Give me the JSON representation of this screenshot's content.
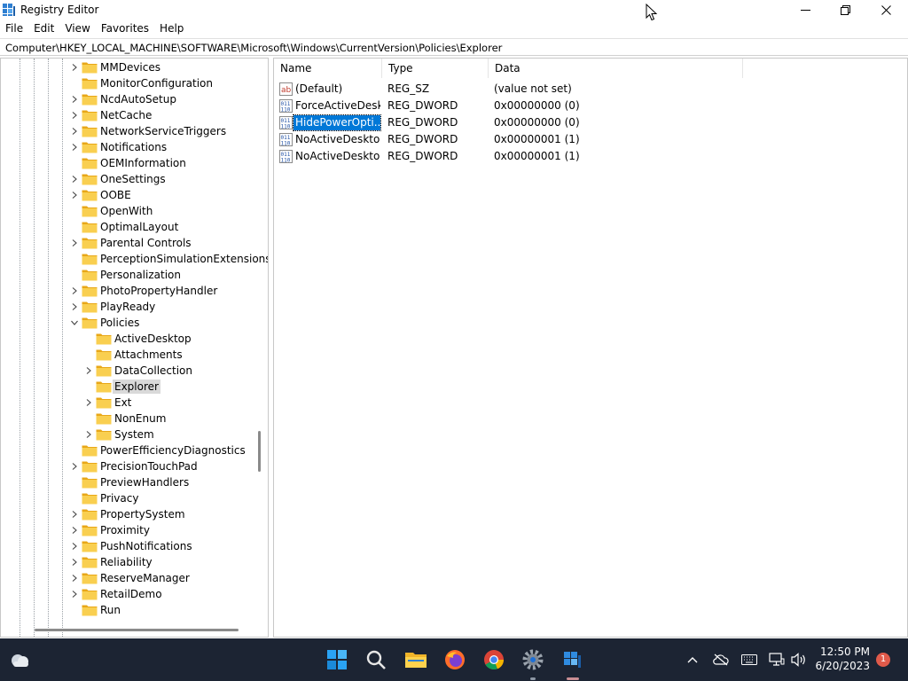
{
  "window": {
    "title": "Registry Editor"
  },
  "menu": [
    "File",
    "Edit",
    "View",
    "Favorites",
    "Help"
  ],
  "address": "Computer\\HKEY_LOCAL_MACHINE\\SOFTWARE\\Microsoft\\Windows\\CurrentVersion\\Policies\\Explorer",
  "tree": [
    {
      "label": "MMDevices",
      "level": 0,
      "chevron": "right"
    },
    {
      "label": "MonitorConfiguration",
      "level": 0,
      "chevron": "none"
    },
    {
      "label": "NcdAutoSetup",
      "level": 0,
      "chevron": "right"
    },
    {
      "label": "NetCache",
      "level": 0,
      "chevron": "right"
    },
    {
      "label": "NetworkServiceTriggers",
      "level": 0,
      "chevron": "right"
    },
    {
      "label": "Notifications",
      "level": 0,
      "chevron": "right"
    },
    {
      "label": "OEMInformation",
      "level": 0,
      "chevron": "none"
    },
    {
      "label": "OneSettings",
      "level": 0,
      "chevron": "right"
    },
    {
      "label": "OOBE",
      "level": 0,
      "chevron": "right"
    },
    {
      "label": "OpenWith",
      "level": 0,
      "chevron": "none"
    },
    {
      "label": "OptimalLayout",
      "level": 0,
      "chevron": "none"
    },
    {
      "label": "Parental Controls",
      "level": 0,
      "chevron": "right"
    },
    {
      "label": "PerceptionSimulationExtensions",
      "level": 0,
      "chevron": "none"
    },
    {
      "label": "Personalization",
      "level": 0,
      "chevron": "none"
    },
    {
      "label": "PhotoPropertyHandler",
      "level": 0,
      "chevron": "right"
    },
    {
      "label": "PlayReady",
      "level": 0,
      "chevron": "right"
    },
    {
      "label": "Policies",
      "level": 0,
      "chevron": "down"
    },
    {
      "label": "ActiveDesktop",
      "level": 1,
      "chevron": "none"
    },
    {
      "label": "Attachments",
      "level": 1,
      "chevron": "none"
    },
    {
      "label": "DataCollection",
      "level": 1,
      "chevron": "right"
    },
    {
      "label": "Explorer",
      "level": 1,
      "chevron": "none",
      "selected": true
    },
    {
      "label": "Ext",
      "level": 1,
      "chevron": "right"
    },
    {
      "label": "NonEnum",
      "level": 1,
      "chevron": "none"
    },
    {
      "label": "System",
      "level": 1,
      "chevron": "right"
    },
    {
      "label": "PowerEfficiencyDiagnostics",
      "level": 0,
      "chevron": "none"
    },
    {
      "label": "PrecisionTouchPad",
      "level": 0,
      "chevron": "right"
    },
    {
      "label": "PreviewHandlers",
      "level": 0,
      "chevron": "none"
    },
    {
      "label": "Privacy",
      "level": 0,
      "chevron": "none"
    },
    {
      "label": "PropertySystem",
      "level": 0,
      "chevron": "right"
    },
    {
      "label": "Proximity",
      "level": 0,
      "chevron": "right"
    },
    {
      "label": "PushNotifications",
      "level": 0,
      "chevron": "right"
    },
    {
      "label": "Reliability",
      "level": 0,
      "chevron": "right"
    },
    {
      "label": "ReserveManager",
      "level": 0,
      "chevron": "right"
    },
    {
      "label": "RetailDemo",
      "level": 0,
      "chevron": "right"
    },
    {
      "label": "Run",
      "level": 0,
      "chevron": "none"
    }
  ],
  "columns": {
    "name": "Name",
    "type": "Type",
    "data": "Data"
  },
  "values": [
    {
      "name": "(Default)",
      "type": "REG_SZ",
      "data": "(value not set)",
      "icon": "string-value-icon"
    },
    {
      "name": "ForceActiveDesk...",
      "type": "REG_DWORD",
      "data": "0x00000000 (0)",
      "icon": "binary-value-icon"
    },
    {
      "name": "HidePowerOpti...",
      "type": "REG_DWORD",
      "data": "0x00000000 (0)",
      "icon": "binary-value-icon",
      "selected": true
    },
    {
      "name": "NoActiveDesktop",
      "type": "REG_DWORD",
      "data": "0x00000001 (1)",
      "icon": "binary-value-icon"
    },
    {
      "name": "NoActiveDeskto...",
      "type": "REG_DWORD",
      "data": "0x00000001 (1)",
      "icon": "binary-value-icon"
    }
  ],
  "taskbar": {
    "time": "12:50 PM",
    "date": "6/20/2023",
    "notification_count": "1",
    "apps": [
      "start-icon",
      "search-icon",
      "file-explorer-icon",
      "firefox-icon",
      "chrome-icon",
      "settings-icon",
      "registry-editor-icon"
    ]
  },
  "colors": {
    "selection": "#0078d7",
    "taskbar": "#1c2433",
    "folder": "#f5c342"
  }
}
